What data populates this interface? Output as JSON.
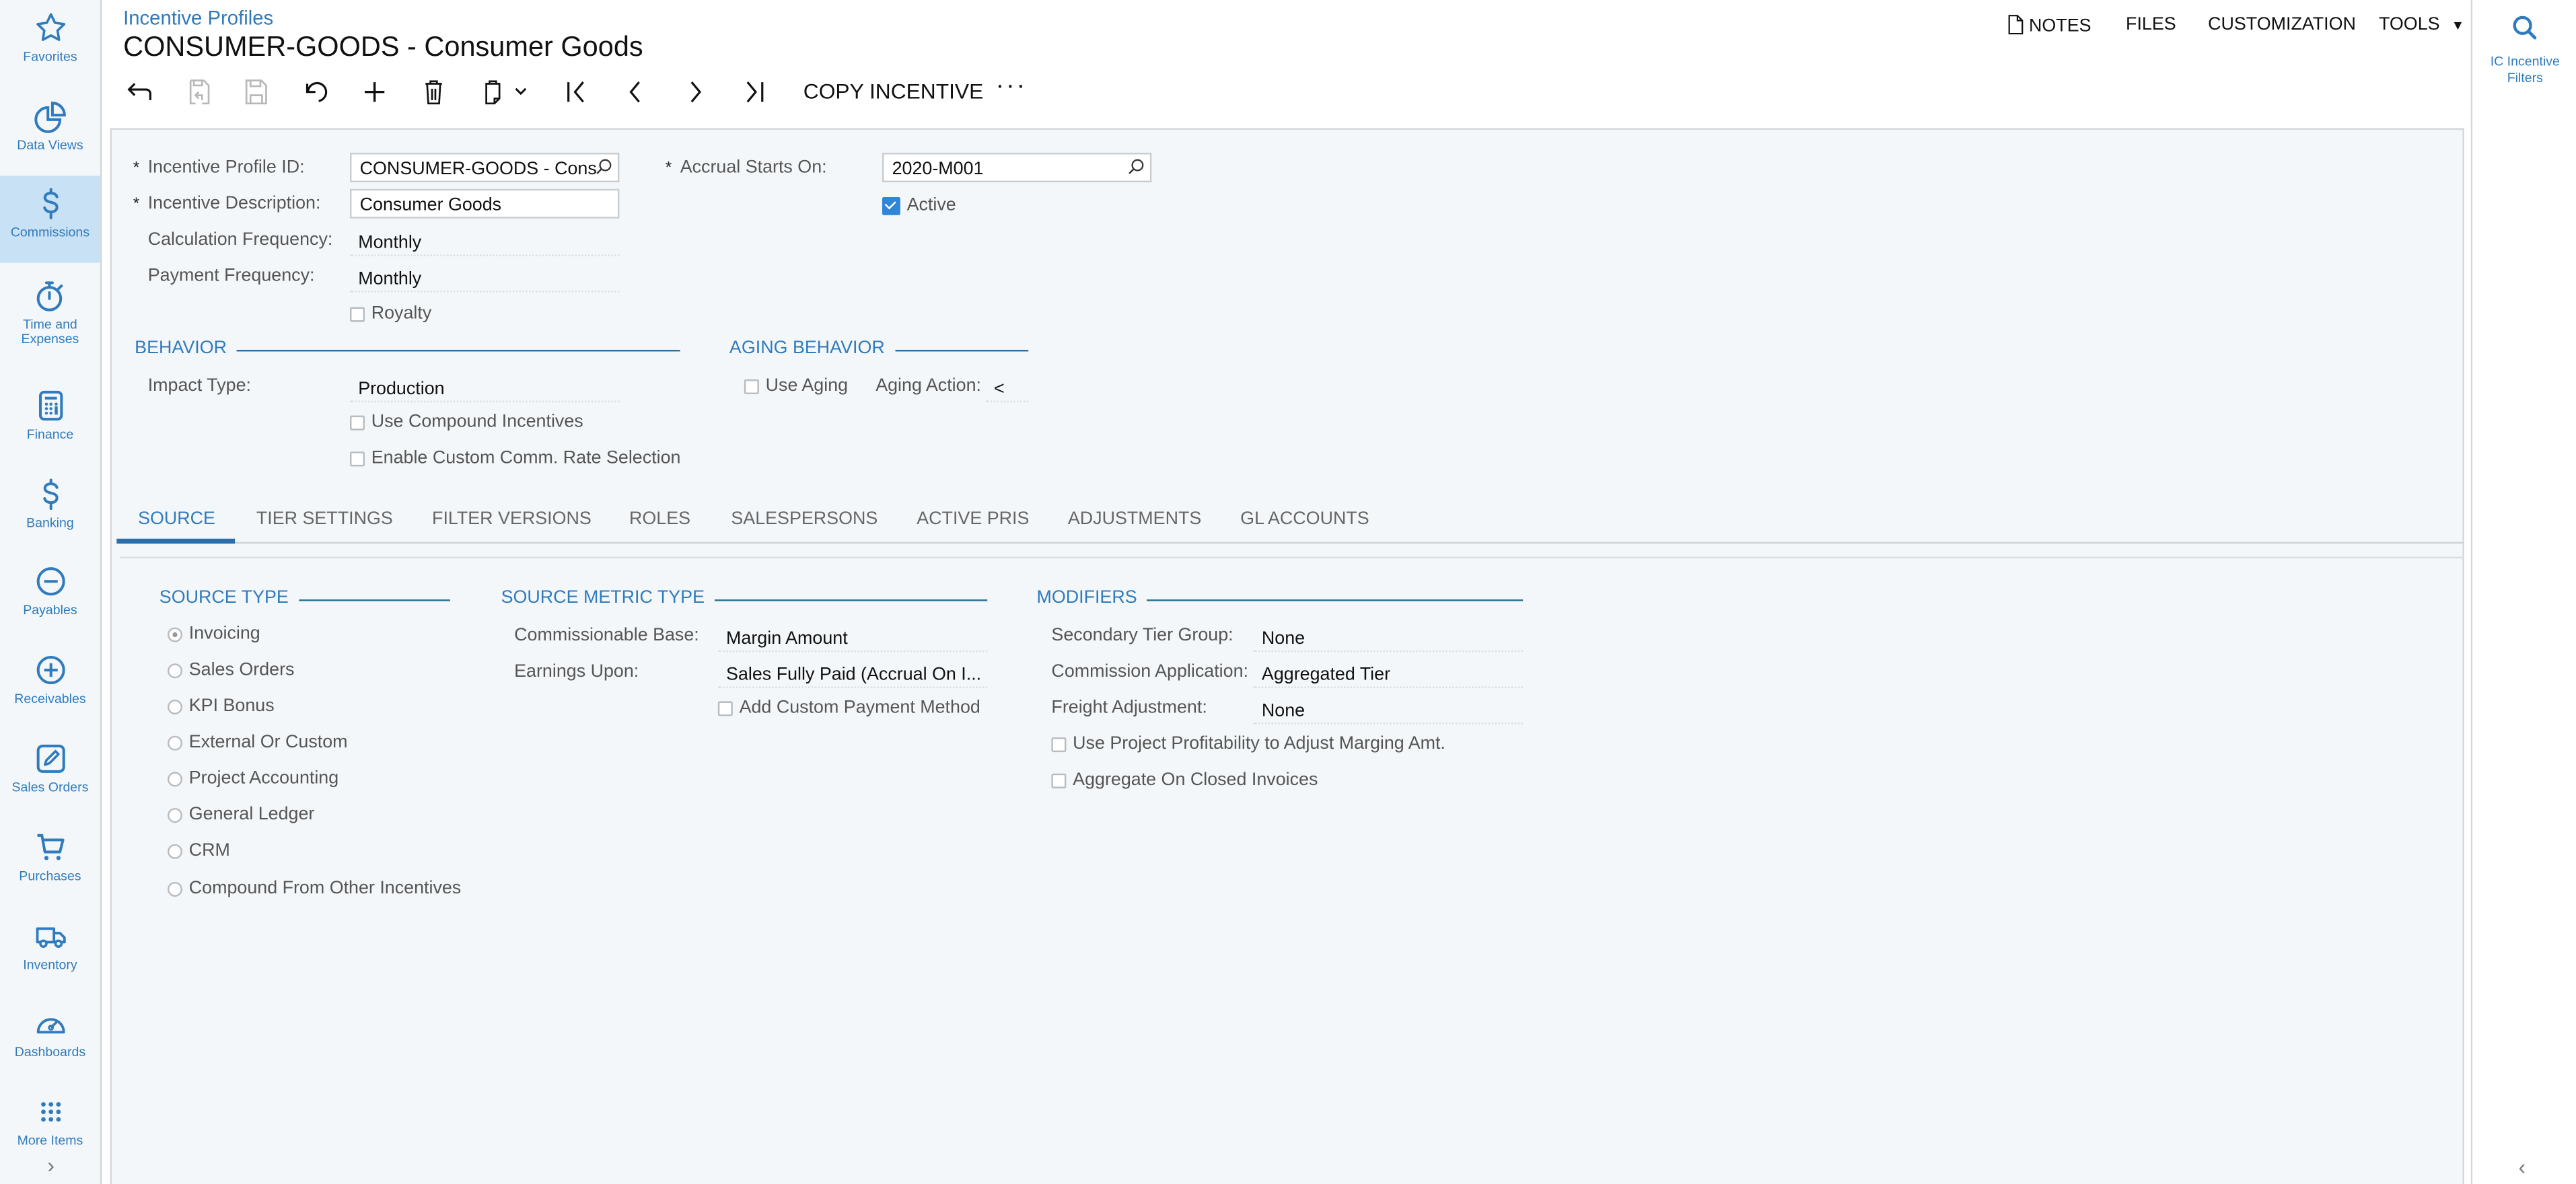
{
  "nav": {
    "items": [
      {
        "label": "Favorites",
        "icon": "star-icon"
      },
      {
        "label": "Data Views",
        "icon": "pie-chart-icon"
      },
      {
        "label": "Commissions",
        "icon": "dollar-icon",
        "active": true
      },
      {
        "label": "Time and Expenses",
        "icon": "stopwatch-icon"
      },
      {
        "label": "Finance",
        "icon": "calculator-icon"
      },
      {
        "label": "Banking",
        "icon": "dollar-icon"
      },
      {
        "label": "Payables",
        "icon": "minus-circle-icon"
      },
      {
        "label": "Receivables",
        "icon": "plus-circle-icon"
      },
      {
        "label": "Sales Orders",
        "icon": "pencil-square-icon"
      },
      {
        "label": "Purchases",
        "icon": "cart-icon"
      },
      {
        "label": "Inventory",
        "icon": "truck-icon"
      },
      {
        "label": "Dashboards",
        "icon": "gauge-icon"
      },
      {
        "label": "More Items",
        "icon": "grid-dots-icon"
      }
    ],
    "expand_glyph": "›"
  },
  "right_panel": {
    "filters_label": "IC Incentive Filters",
    "collapse_glyph": "‹"
  },
  "header": {
    "breadcrumb": "Incentive Profiles",
    "title": "CONSUMER-GOODS - Consumer Goods",
    "top_actions": {
      "notes": "NOTES",
      "files": "FILES",
      "customization": "CUSTOMIZATION",
      "tools": "TOOLS"
    }
  },
  "toolbar": {
    "copy_incentive": "COPY INCENTIVE",
    "more": "···"
  },
  "summary": {
    "incentive_profile_id_label": "Incentive Profile ID:",
    "incentive_profile_id_value": "CONSUMER-GOODS - Cons",
    "incentive_description_label": "Incentive Description:",
    "incentive_description_value": "Consumer Goods",
    "calculation_frequency_label": "Calculation Frequency:",
    "calculation_frequency_value": "Monthly",
    "payment_frequency_label": "Payment Frequency:",
    "payment_frequency_value": "Monthly",
    "royalty_label": "Royalty",
    "royalty_checked": false,
    "accrual_starts_on_label": "Accrual Starts On:",
    "accrual_starts_on_value": "2020-M001",
    "active_label": "Active",
    "active_checked": true,
    "required_mark": "*"
  },
  "behavior": {
    "title": "BEHAVIOR",
    "impact_type_label": "Impact Type:",
    "impact_type_value": "Production",
    "use_compound_label": "Use Compound Incentives",
    "enable_custom_rate_label": "Enable Custom Comm. Rate Selection"
  },
  "aging_behavior": {
    "title": "AGING BEHAVIOR",
    "use_aging_label": "Use Aging",
    "aging_action_label": "Aging Action:",
    "aging_action_value": "<"
  },
  "tabs": [
    {
      "label": "SOURCE",
      "active": true
    },
    {
      "label": "TIER SETTINGS"
    },
    {
      "label": "FILTER VERSIONS"
    },
    {
      "label": "ROLES"
    },
    {
      "label": "SALESPERSONS"
    },
    {
      "label": "ACTIVE PRIS"
    },
    {
      "label": "ADJUSTMENTS"
    },
    {
      "label": "GL ACCOUNTS"
    }
  ],
  "source_type": {
    "title": "SOURCE TYPE",
    "options": [
      "Invoicing",
      "Sales Orders",
      "KPI Bonus",
      "External Or Custom",
      "Project Accounting",
      "General Ledger",
      "CRM",
      "Compound From Other Incentives"
    ],
    "selected": "Invoicing"
  },
  "source_metric_type": {
    "title": "SOURCE METRIC TYPE",
    "commissionable_base_label": "Commissionable Base:",
    "commissionable_base_value": "Margin Amount",
    "earnings_upon_label": "Earnings Upon:",
    "earnings_upon_value": "Sales Fully Paid (Accrual On I...",
    "add_custom_payment_label": "Add Custom Payment Method"
  },
  "modifiers": {
    "title": "MODIFIERS",
    "secondary_tier_group_label": "Secondary Tier Group:",
    "secondary_tier_group_value": "None",
    "commission_application_label": "Commission Application:",
    "commission_application_value": "Aggregated Tier",
    "freight_adjustment_label": "Freight Adjustment:",
    "freight_adjustment_value": "None",
    "use_project_profitability_label": "Use Project Profitability to Adjust Marging Amt.",
    "aggregate_closed_invoices_label": "Aggregate On Closed Invoices"
  },
  "colors": {
    "accent": "#2f7bbd",
    "nav_active_bg": "#c8e1f4",
    "panel_bg": "#f4f7f9",
    "checkbox_checked": "#2f86d6"
  }
}
